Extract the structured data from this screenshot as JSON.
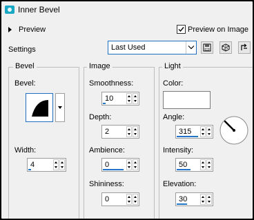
{
  "title": "Inner Bevel",
  "preview": {
    "label": "Preview"
  },
  "preview_on_image": {
    "label": "Preview on Image",
    "checked": true
  },
  "settings": {
    "label": "Settings",
    "preset": "Last Used",
    "buttons": [
      "save-preset-icon",
      "randomize-icon",
      "reset-icon"
    ]
  },
  "bevel": {
    "group_label": "Bevel",
    "bevel_label": "Bevel:",
    "width_label": "Width:",
    "width_value": "4"
  },
  "image": {
    "group_label": "Image",
    "smoothness_label": "Smoothness:",
    "smoothness_value": "10",
    "depth_label": "Depth:",
    "depth_value": "2",
    "ambience_label": "Ambience:",
    "ambience_value": "0",
    "shininess_label": "Shininess:",
    "shininess_value": "0"
  },
  "light": {
    "group_label": "Light",
    "color_label": "Color:",
    "color": "#ffffff",
    "angle_label": "Angle:",
    "angle_value": "315",
    "intensity_label": "Intensity:",
    "intensity_value": "50",
    "elevation_label": "Elevation:",
    "elevation_value": "30"
  },
  "colors": {
    "accent": "#1e74c8",
    "panel": "#f0f0f0",
    "title_icon": "#1aa7c4"
  }
}
